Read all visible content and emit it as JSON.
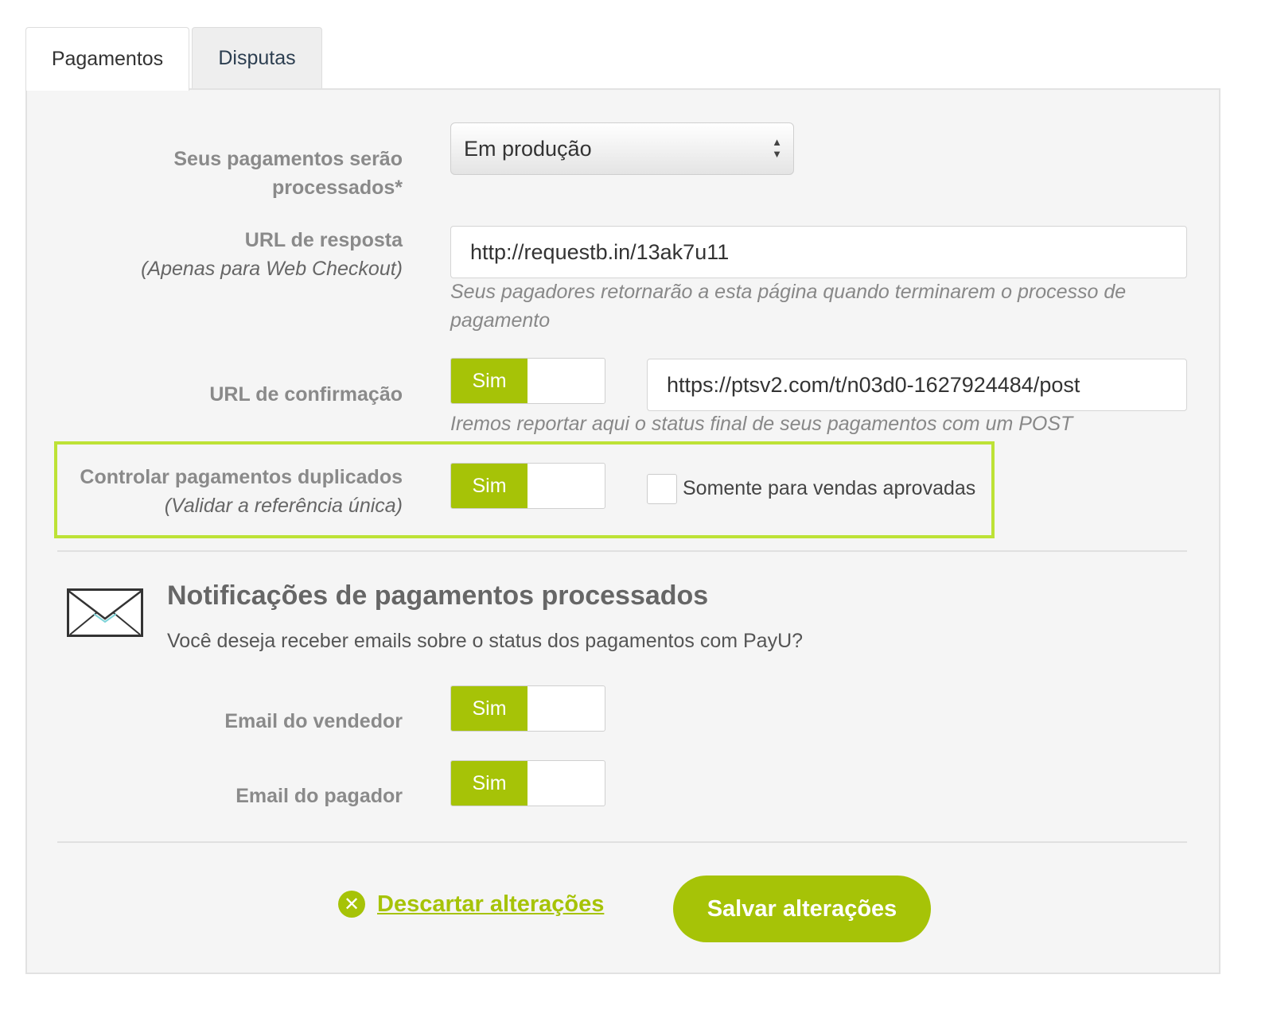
{
  "tabs": [
    {
      "label": "Pagamentos",
      "active": true
    },
    {
      "label": "Disputas",
      "active": false
    }
  ],
  "form": {
    "processing": {
      "label": "Seus pagamentos serão processados*",
      "selected": "Em produção"
    },
    "response_url": {
      "label": "URL de resposta",
      "sublabel": "(Apenas para Web Checkout)",
      "value": "http://requestb.in/13ak7u11",
      "help": "Seus pagadores retornarão a esta página quando terminarem o processo de pagamento"
    },
    "confirmation_url": {
      "label": "URL de confirmação",
      "toggle": "Sim",
      "value": "https://ptsv2.com/t/n03d0-1627924484/post",
      "help": "Iremos reportar aqui o status final de seus pagamentos com um POST"
    },
    "duplicates": {
      "label": "Controlar pagamentos duplicados",
      "sublabel": "(Validar a referência única)",
      "toggle": "Sim",
      "checkbox_label": "Somente para vendas aprovadas",
      "checkbox_checked": false
    }
  },
  "notifications": {
    "icon": "envelope-icon",
    "title": "Notificações de pagamentos processados",
    "description": "Você deseja receber emails sobre o status dos pagamentos com PayU?",
    "seller_email": {
      "label": "Email do vendedor",
      "toggle": "Sim"
    },
    "payer_email": {
      "label": "Email do pagador",
      "toggle": "Sim"
    }
  },
  "actions": {
    "discard_label": "Descartar alterações",
    "save_label": "Salvar alterações"
  },
  "colors": {
    "accent": "#a6c307",
    "highlight_border": "#bde236"
  }
}
